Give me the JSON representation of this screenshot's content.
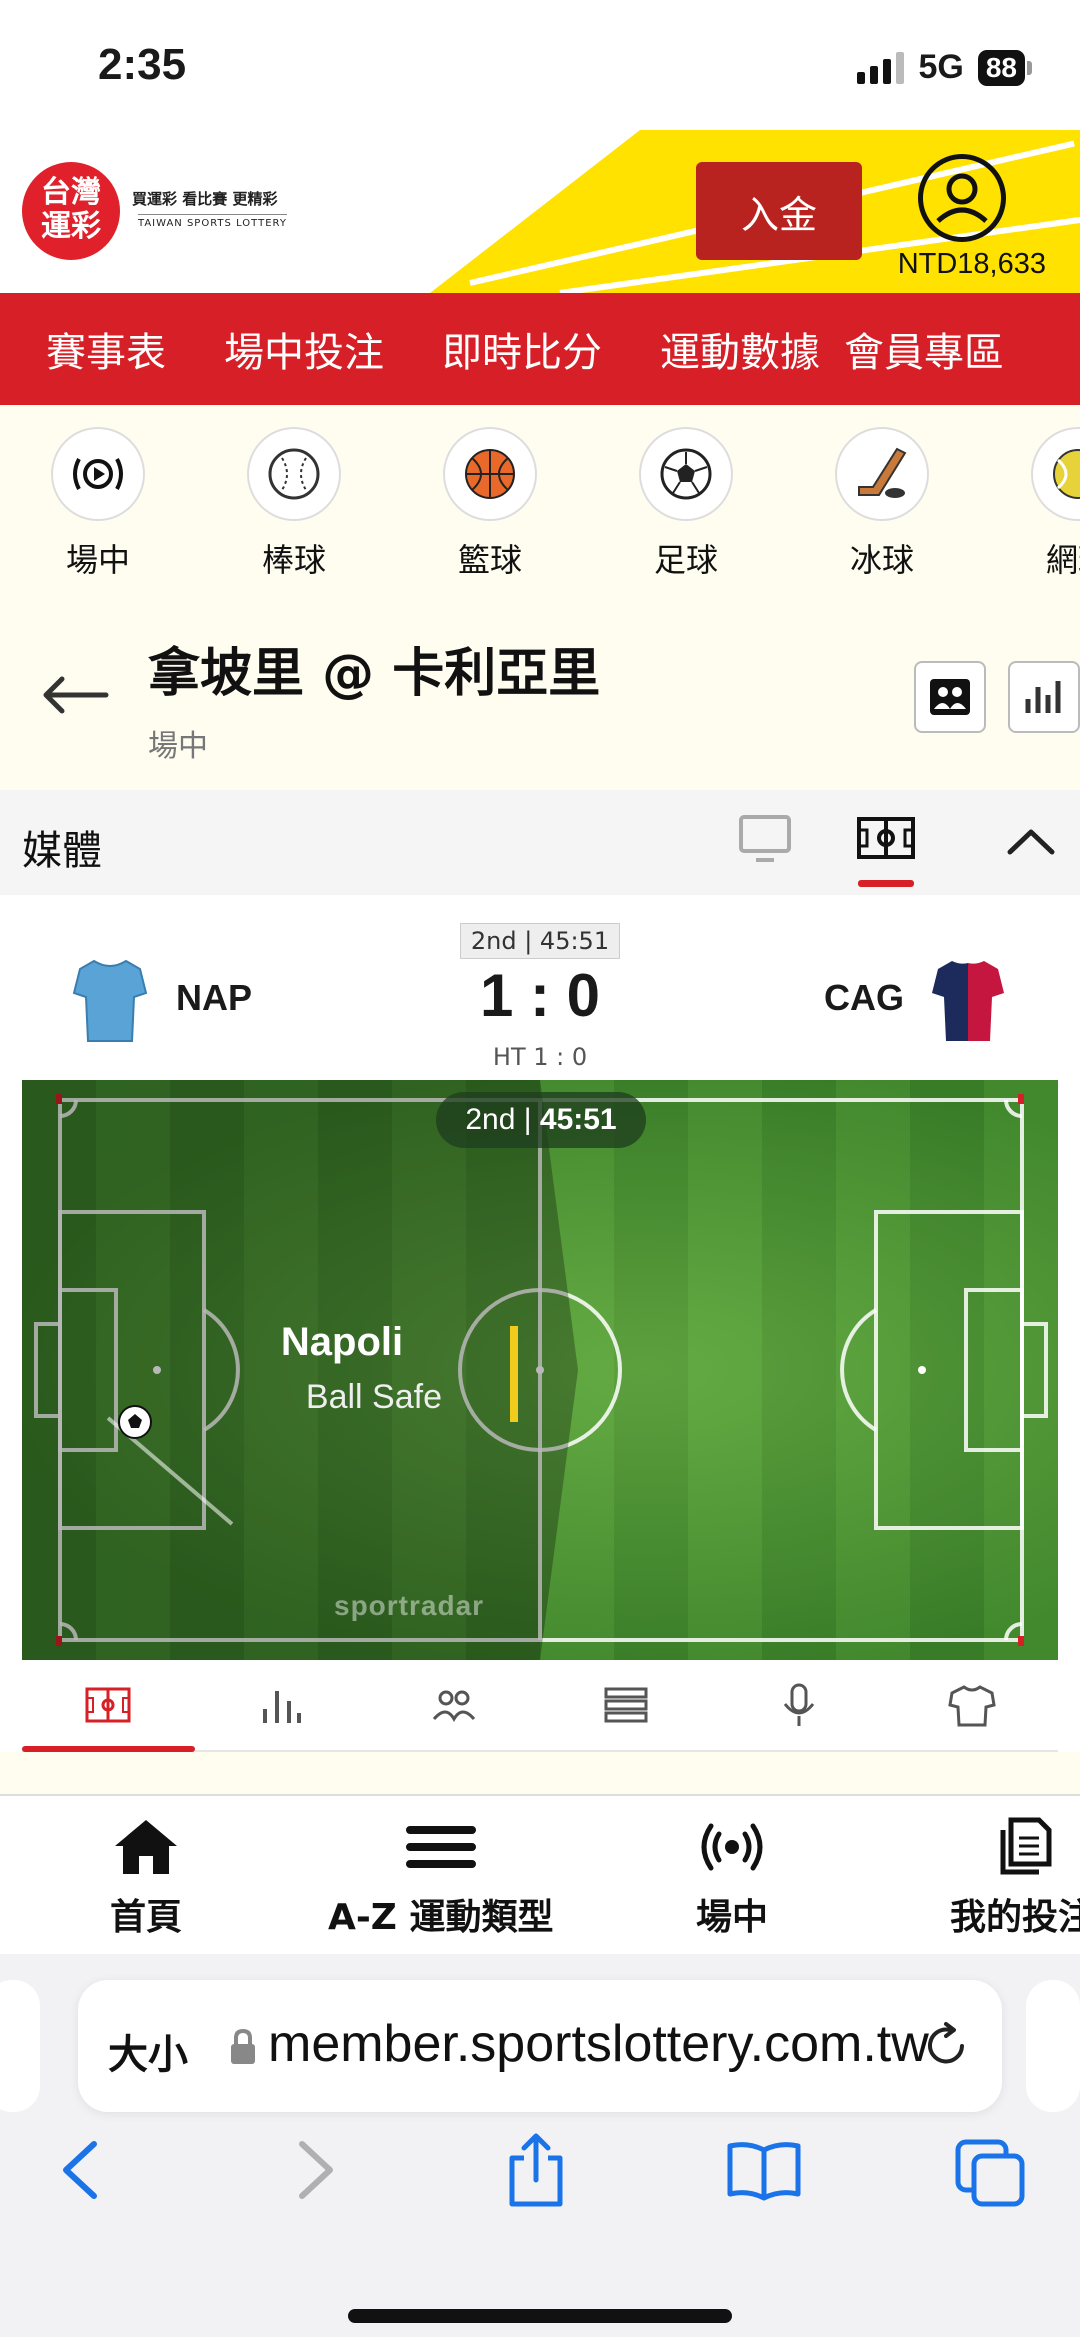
{
  "status_bar": {
    "time": "2:35",
    "network": "5G",
    "battery": "88"
  },
  "header": {
    "logo_line1": "台灣",
    "logo_line2": "運彩",
    "logo_slogan": "買運彩 看比賽 更精彩",
    "logo_sub": "TAIWAN SPORTS LOTTERY",
    "deposit_label": "入金",
    "balance": "NTD18,633",
    "accent_color": "#d61f26",
    "brand_yellow": "#ffe200"
  },
  "nav": {
    "items": [
      "賽事表",
      "場中投注",
      "即時比分",
      "運動數據",
      "會員專區"
    ]
  },
  "sports": [
    {
      "label": "場中",
      "icon": "live-broadcast-icon"
    },
    {
      "label": "棒球",
      "icon": "baseball-icon"
    },
    {
      "label": "籃球",
      "icon": "basketball-icon"
    },
    {
      "label": "足球",
      "icon": "soccer-ball-icon"
    },
    {
      "label": "冰球",
      "icon": "ice-hockey-icon"
    },
    {
      "label": "網球",
      "icon": "tennis-ball-icon"
    }
  ],
  "match": {
    "title": "拿坡里 @ 卡利亞里",
    "subtitle": "場中"
  },
  "media": {
    "title": "媒體"
  },
  "scoreboard": {
    "period": "2nd | 45:51",
    "home_abbr": "NAP",
    "away_abbr": "CAG",
    "score": "1 : 0",
    "halftime": "HT 1 : 0"
  },
  "pitch": {
    "period": "2nd",
    "clock": "45:51",
    "event_team": "Napoli",
    "event_desc": "Ball Safe",
    "watermark": "sportradar"
  },
  "pitch_tabs": [
    "pitch-icon",
    "stats-icon",
    "lineup-icon",
    "list-icon",
    "commentary-icon",
    "shirt-icon"
  ],
  "bottom_nav": [
    {
      "label": "首頁",
      "icon": "home-icon"
    },
    {
      "label": "A-Z 運動類型",
      "icon": "menu-icon"
    },
    {
      "label": "場中",
      "icon": "live-icon"
    },
    {
      "label": "我的投注",
      "icon": "bets-icon"
    }
  ],
  "browser": {
    "aa_label": "大小",
    "url": "member.sportslottery.com.tw"
  }
}
